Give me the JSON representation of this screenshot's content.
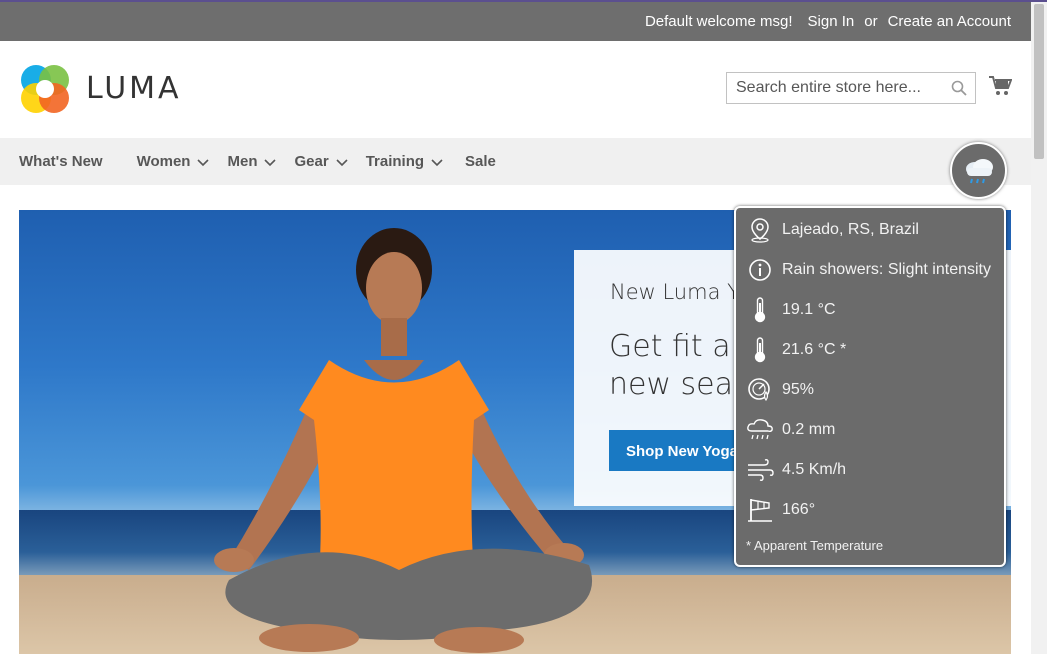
{
  "header": {
    "welcome": "Default welcome msg!",
    "sign_in": "Sign In",
    "or": "or",
    "create_account": "Create an Account"
  },
  "logo": {
    "text": "LUMA"
  },
  "search": {
    "placeholder": "Search entire store here..."
  },
  "nav": {
    "items": [
      {
        "label": "What's New",
        "dropdown": false
      },
      {
        "label": "Women",
        "dropdown": true
      },
      {
        "label": "Men",
        "dropdown": true
      },
      {
        "label": "Gear",
        "dropdown": true
      },
      {
        "label": "Training",
        "dropdown": true
      },
      {
        "label": "Sale",
        "dropdown": false
      }
    ]
  },
  "hero": {
    "subtitle": "New Luma Yoga Collection",
    "headline": "Get fit and look fab in new seasonal styles",
    "button": "Shop New Yoga"
  },
  "weather": {
    "button_icon": "rain-cloud-icon",
    "location": "Lajeado, RS, Brazil",
    "condition": "Rain showers: Slight intensity",
    "temperature": "19.1 °C",
    "apparent_temperature": "21.6 °C *",
    "humidity": "95%",
    "precipitation": "0.2 mm",
    "wind_speed": "4.5 Km/h",
    "wind_direction": "166°",
    "footnote": "* Apparent Temperature"
  },
  "colors": {
    "header_bar": "#6e6e6e",
    "nav_bar": "#f0f0f0",
    "primary_button": "#1979c3",
    "weather_panel": "#6b6b6b"
  }
}
